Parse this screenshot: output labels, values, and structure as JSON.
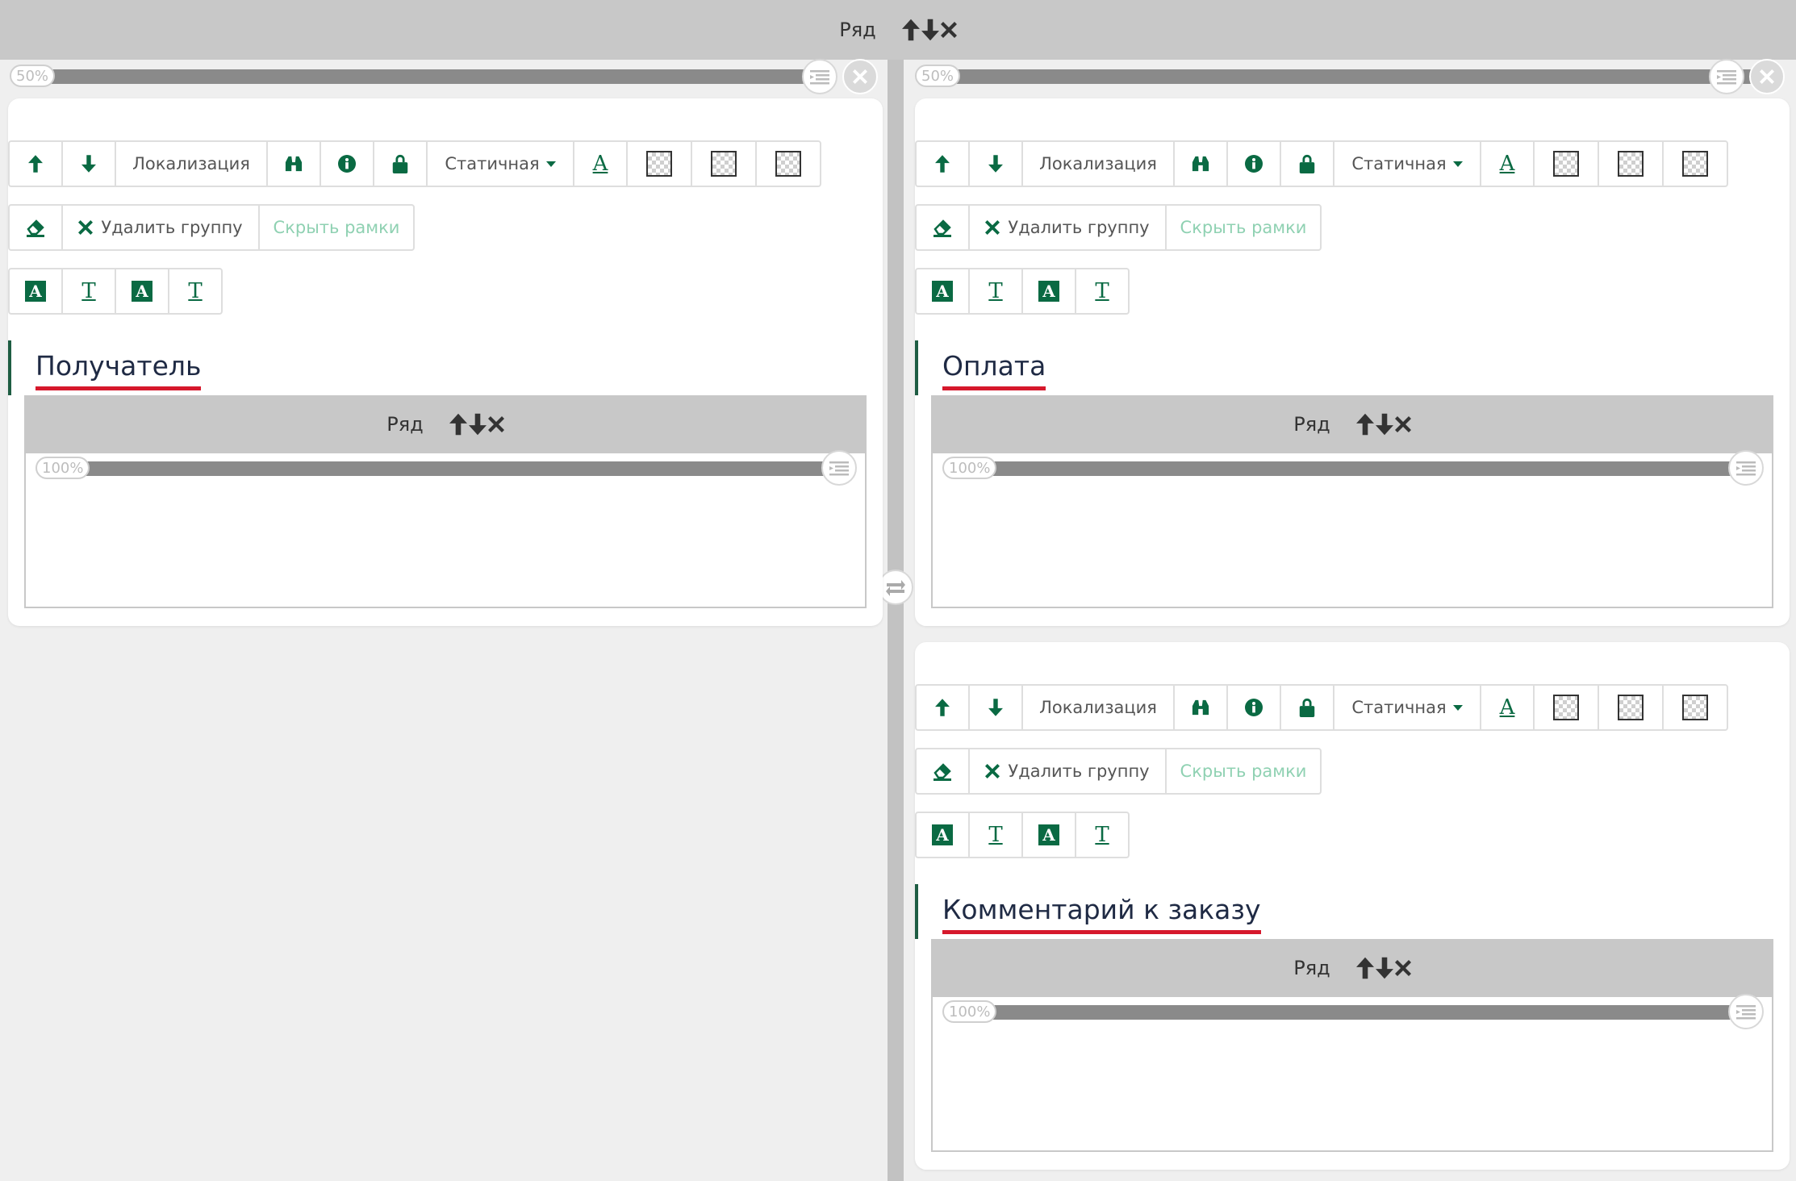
{
  "row_label": "Ряд",
  "columns": [
    {
      "width_label": "50%"
    },
    {
      "width_label": "50%"
    }
  ],
  "toolbar": {
    "localization": "Локализация",
    "static": "Статичная",
    "delete_group": "Удалить группу",
    "hide_frames": "Скрыть рамки"
  },
  "groups": [
    {
      "title": "Получатель",
      "inner_row_label": "Ряд",
      "inner_width_label": "100%"
    },
    {
      "title": "Оплата",
      "inner_row_label": "Ряд",
      "inner_width_label": "100%"
    },
    {
      "title": "Комментарий к заказу",
      "inner_row_label": "Ряд",
      "inner_width_label": "100%"
    }
  ],
  "colors": {
    "accent_green": "#0a6a43",
    "underline_red": "#d6182c",
    "header_gray": "#c8c8c8"
  },
  "icons": [
    "arrow-up-icon",
    "arrow-down-icon",
    "close-icon",
    "binoculars-icon",
    "info-icon",
    "lock-icon",
    "eraser-icon",
    "list-icon",
    "swap-icon"
  ]
}
